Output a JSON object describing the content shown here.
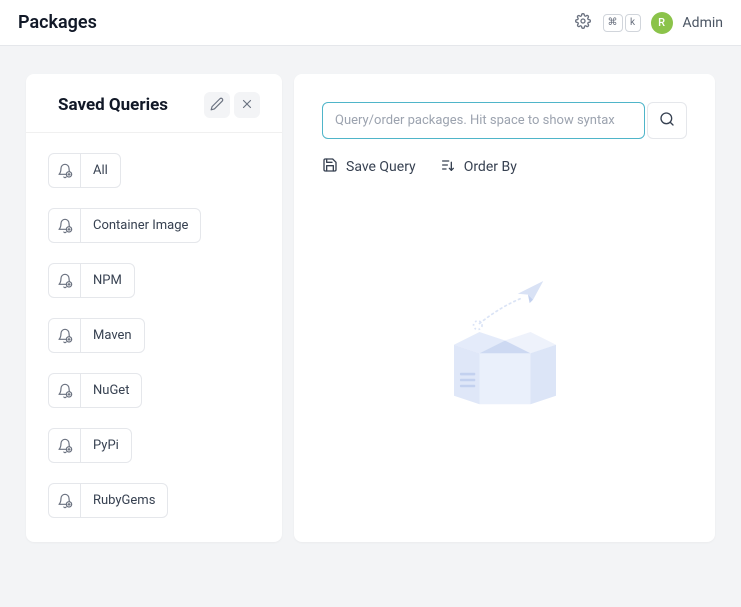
{
  "header": {
    "title": "Packages",
    "shortcut_cmd": "⌘",
    "shortcut_key": "k",
    "user_initial": "R",
    "user_name": "Admin"
  },
  "sidebar": {
    "title": "Saved Queries",
    "items": [
      {
        "label": "All"
      },
      {
        "label": "Container Image"
      },
      {
        "label": "NPM"
      },
      {
        "label": "Maven"
      },
      {
        "label": "NuGet"
      },
      {
        "label": "PyPi"
      },
      {
        "label": "RubyGems"
      }
    ]
  },
  "main": {
    "search_placeholder": "Query/order packages. Hit space to show syntax",
    "save_query_label": "Save Query",
    "order_by_label": "Order By"
  }
}
